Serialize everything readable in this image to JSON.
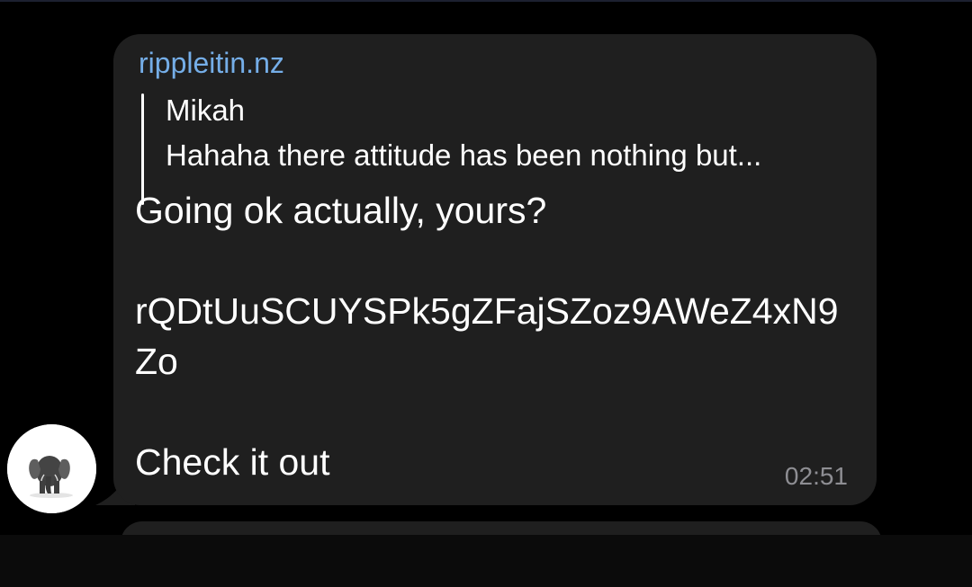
{
  "message": {
    "sender": "rippleitin.nz",
    "reply": {
      "author": "Mikah",
      "preview": "Hahaha there attitude has been nothing but..."
    },
    "text": "Going ok actually, yours?\n\nrQDtUuSCUYSPk5gZFajSZoz9AWeZ4xN9Zo\n\nCheck it out",
    "time": "02:51"
  },
  "avatar": {
    "icon": "elephant-icon"
  },
  "colors": {
    "background": "#000000",
    "bubble": "#1f1f1f",
    "sender_name": "#75aee8",
    "timestamp": "#8e8e93"
  }
}
